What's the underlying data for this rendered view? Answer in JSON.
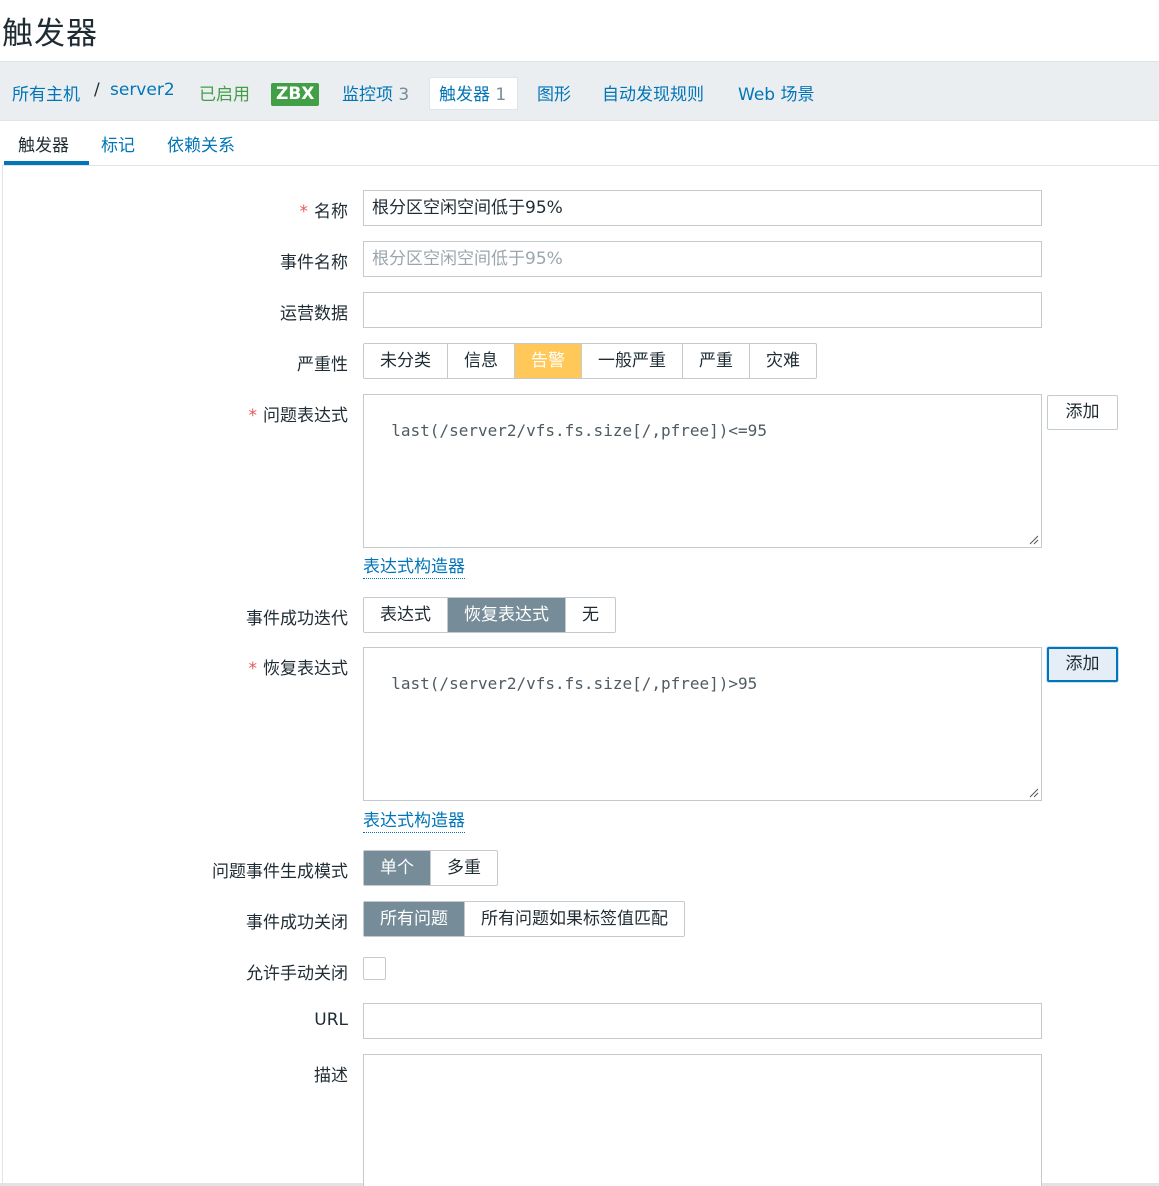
{
  "page": {
    "title": "触发器"
  },
  "host_nav": {
    "all_hosts": "所有主机",
    "separator": "/",
    "host": "server2",
    "status": "已启用",
    "zbx_badge": "ZBX",
    "items_label": "监控项",
    "items_count": "3",
    "triggers_label": "触发器",
    "triggers_count": "1",
    "graphs": "图形",
    "discovery": "自动发现规则",
    "web": "Web 场景"
  },
  "tabs": {
    "trigger": "触发器",
    "tags": "标记",
    "dependencies": "依赖关系"
  },
  "form": {
    "name": {
      "label": "名称",
      "value": "根分区空闲空间低于95%"
    },
    "event_name": {
      "label": "事件名称",
      "placeholder": "根分区空闲空间低于95%"
    },
    "opdata": {
      "label": "运营数据",
      "value": ""
    },
    "severity": {
      "label": "严重性",
      "options": [
        "未分类",
        "信息",
        "告警",
        "一般严重",
        "严重",
        "灾难"
      ],
      "selected": "告警"
    },
    "expression": {
      "label": "问题表达式",
      "value": "last(/server2/vfs.fs.size[/,pfree])<=95",
      "add_button": "添加",
      "builder_link": "表达式构造器"
    },
    "recovery_mode": {
      "label": "事件成功迭代",
      "options": [
        "表达式",
        "恢复表达式",
        "无"
      ],
      "selected": "恢复表达式"
    },
    "recovery_expression": {
      "label": "恢复表达式",
      "value": "last(/server2/vfs.fs.size[/,pfree])>95",
      "add_button": "添加",
      "builder_link": "表达式构造器"
    },
    "problem_mode": {
      "label": "问题事件生成模式",
      "options": [
        "单个",
        "多重"
      ],
      "selected": "单个"
    },
    "ok_close": {
      "label": "事件成功关闭",
      "options": [
        "所有问题",
        "所有问题如果标签值匹配"
      ],
      "selected": "所有问题"
    },
    "manual_close": {
      "label": "允许手动关闭",
      "checked": false
    },
    "url": {
      "label": "URL",
      "value": ""
    },
    "description": {
      "label": "描述",
      "value": ""
    }
  },
  "colors": {
    "link": "#0275b8",
    "enabled": "#429e47",
    "warning": "#ffc859",
    "selected": "#768d99",
    "required": "#e45959"
  }
}
